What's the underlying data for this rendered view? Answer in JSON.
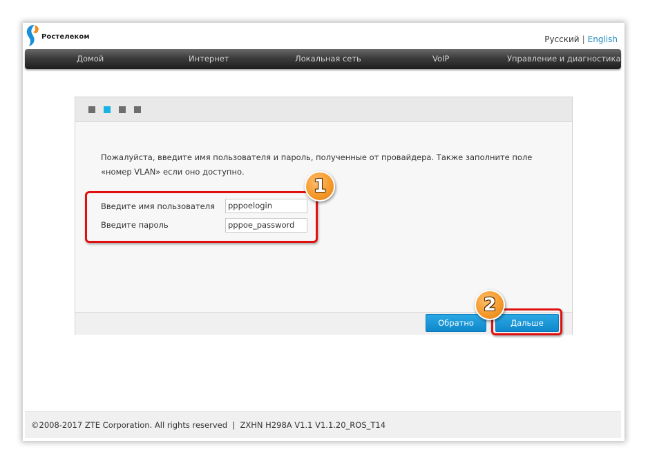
{
  "brand": {
    "name": "Ростелеком",
    "logo_icon": "rostelecom-logo-icon",
    "accent": "#1ab2e4"
  },
  "language": {
    "ru": "Русский",
    "separator": "|",
    "en": "English"
  },
  "nav": {
    "items": [
      {
        "label": "Домой"
      },
      {
        "label": "Интернет"
      },
      {
        "label": "Локальная сеть"
      },
      {
        "label": "VoIP"
      },
      {
        "label": "Управление и диагностика"
      }
    ]
  },
  "wizard": {
    "steps_total": 4,
    "current_step": 2,
    "instruction": "Пожалуйста, введите имя пользователя и пароль, полученные от провайдера. Также заполните поле «номер VLAN» если оно доступно.",
    "username": {
      "label": "Введите имя пользователя",
      "value": "pppoelogin"
    },
    "password": {
      "label": "Введите пароль",
      "value": "pppoe_password"
    },
    "back_label": "Обратно",
    "next_label": "Дальше"
  },
  "annotations": {
    "badge1": "1",
    "badge2": "2",
    "highlight_color": "#e01010",
    "badge_color": "#f59a2b"
  },
  "footer": {
    "copyright": "©2008-2017 ZTE Corporation. All rights reserved",
    "separator": "|",
    "version": "ZXHN H298A V1.1 V1.1.20_ROS_T14"
  }
}
